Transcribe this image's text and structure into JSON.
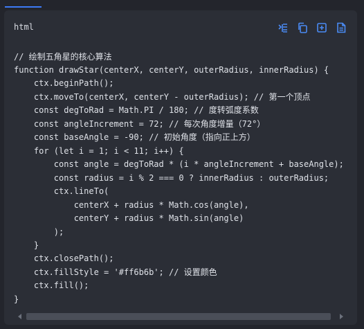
{
  "header": {
    "language": "html",
    "icons": [
      "insert-code-icon",
      "copy-icon",
      "add-file-icon",
      "save-file-icon"
    ],
    "accent_color": "#3d7bf7"
  },
  "code": {
    "lines": [
      "// 绘制五角星的核心算法",
      "function drawStar(centerX, centerY, outerRadius, innerRadius) {",
      "    ctx.beginPath();",
      "    ctx.moveTo(centerX, centerY - outerRadius); // 第一个顶点",
      "    const degToRad = Math.PI / 180; // 度转弧度系数",
      "    const angleIncrement = 72; // 每次角度增量（72°）",
      "    const baseAngle = -90; // 初始角度（指向正上方）",
      "    for (let i = 1; i < 11; i++) {",
      "        const angle = degToRad * (i * angleIncrement + baseAngle);",
      "        const radius = i % 2 === 0 ? innerRadius : outerRadius;",
      "        ctx.lineTo(",
      "            centerX + radius * Math.cos(angle),",
      "            centerY + radius * Math.sin(angle)",
      "        );",
      "    }",
      "    ctx.closePath();",
      "    ctx.fillStyle = '#ff6b6b'; // 设置颜色",
      "    ctx.fill();",
      "}"
    ]
  }
}
